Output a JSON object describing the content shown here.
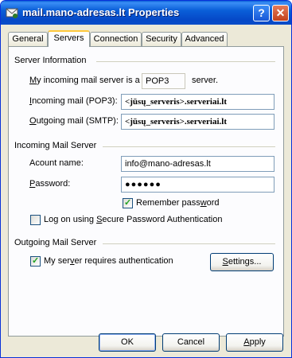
{
  "window": {
    "title": "mail.mano-adresas.lt Properties",
    "help_button": "?",
    "close_button": "✕"
  },
  "tabs": [
    {
      "label": "General"
    },
    {
      "label": "Servers"
    },
    {
      "label": "Connection"
    },
    {
      "label": "Security"
    },
    {
      "label": "Advanced"
    }
  ],
  "server_info": {
    "group": "Server Information",
    "incoming_type_label_pre": "y incoming mail server is a",
    "incoming_type_label_accel": "M",
    "incoming_type_value": "POP3",
    "incoming_type_suffix": "server.",
    "incoming_label_accel": "I",
    "incoming_label_rest": "ncoming mail (POP3):",
    "incoming_value": "<jūsų_serveris>.serveriai.lt",
    "outgoing_label_accel": "O",
    "outgoing_label_rest": "utgoing mail (SMTP):",
    "outgoing_value": "<jūsų_serveris>.serveriai.lt"
  },
  "incoming_server": {
    "group": "Incoming Mail Server",
    "account_label_pre": "Ac",
    "account_label_accel": "c",
    "account_label_rest": "ount name:",
    "account_value": "info@mano-adresas.lt",
    "password_label_accel": "P",
    "password_label_rest": "assword:",
    "password_value": "●●●●●●",
    "remember_label_pre": "Remember pass",
    "remember_label_accel": "w",
    "remember_label_rest": "ord",
    "remember_checked": true,
    "spa_label_pre": "Log on using ",
    "spa_label_accel": "S",
    "spa_label_rest": "ecure Password Authentication",
    "spa_checked": false
  },
  "outgoing_server": {
    "group": "Outgoing Mail Server",
    "auth_label_pre": "My ser",
    "auth_label_accel": "v",
    "auth_label_rest": "er requires authentication",
    "auth_checked": true,
    "settings_accel": "S",
    "settings_rest": "ettings..."
  },
  "buttons": {
    "ok": "OK",
    "cancel": "Cancel",
    "apply_accel": "A",
    "apply_rest": "pply"
  },
  "colors": {
    "titlebar": "#0a5fd8",
    "tab_highlight": "#ffc83c",
    "check_mark": "#21a121"
  }
}
